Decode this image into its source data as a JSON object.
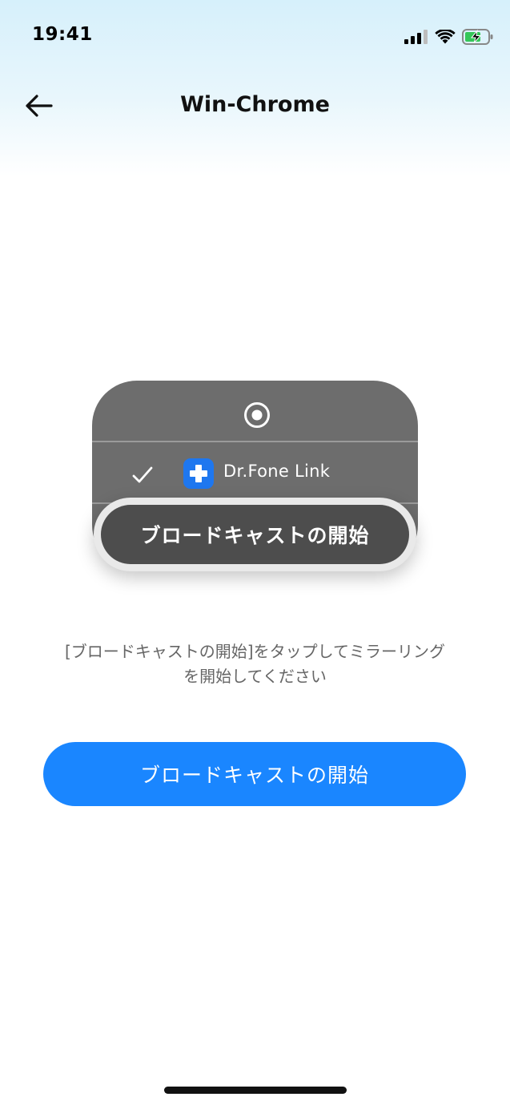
{
  "status_bar": {
    "time": "19:41",
    "icons": [
      "cellular-signal-icon",
      "wifi-icon",
      "battery-charging-icon"
    ]
  },
  "nav": {
    "back_icon": "arrow-left-icon",
    "title": "Win-Chrome"
  },
  "illustration": {
    "record_icon": "screen-record-icon",
    "check_icon": "checkmark-icon",
    "app_icon": "drfone-plus-icon",
    "app_name": "Dr.Fone Link",
    "pill_label": "ブロードキャストの開始"
  },
  "instruction": {
    "line1": "[ブロードキャストの開始]をタップしてミラーリング",
    "line2": "を開始してください"
  },
  "cta": {
    "label": "ブロードキャストの開始"
  },
  "colors": {
    "accent": "#1a86ff",
    "card_bg": "#6d6d6d",
    "app_icon_bg": "#1e77ef",
    "instruction_text": "#666666"
  }
}
